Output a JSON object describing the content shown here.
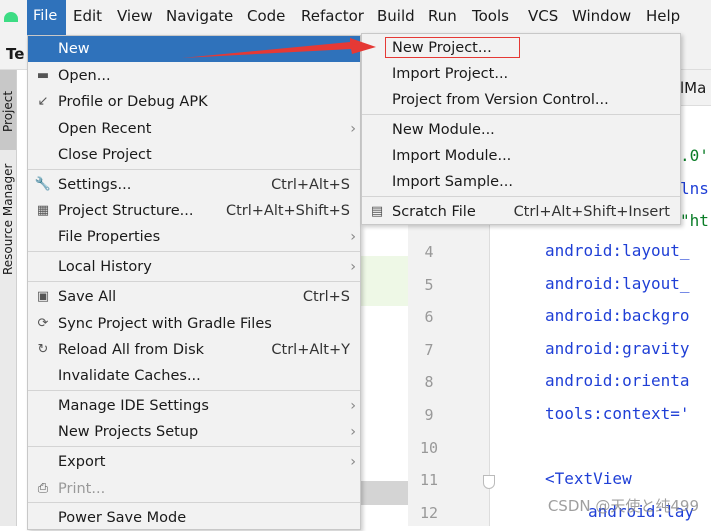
{
  "menubar": {
    "items": [
      "File",
      "Edit",
      "View",
      "Navigate",
      "Code",
      "Refactor",
      "Build",
      "Run",
      "Tools",
      "VCS",
      "Window",
      "Help"
    ]
  },
  "tabrow": {
    "project_tab": "Te",
    "editor_tab": "lMa"
  },
  "sidebar": {
    "project": "Project",
    "resource_manager": "Resource Manager"
  },
  "file_menu": {
    "items": [
      {
        "label": "New",
        "icon": "",
        "shortcut": "",
        "submenu": true
      },
      {
        "label": "Open...",
        "icon": "folder-icon",
        "shortcut": ""
      },
      {
        "label": "Profile or Debug APK",
        "icon": "profile-apk-icon",
        "shortcut": ""
      },
      {
        "label": "Open Recent",
        "icon": "",
        "shortcut": "",
        "submenu": true
      },
      {
        "label": "Close Project",
        "icon": "",
        "shortcut": ""
      },
      {
        "label": "Settings...",
        "icon": "wrench-icon",
        "shortcut": "Ctrl+Alt+S"
      },
      {
        "label": "Project Structure...",
        "icon": "project-structure-icon",
        "shortcut": "Ctrl+Alt+Shift+S"
      },
      {
        "label": "File Properties",
        "icon": "",
        "shortcut": "",
        "submenu": true
      },
      {
        "label": "Local History",
        "icon": "",
        "shortcut": "",
        "submenu": true
      },
      {
        "label": "Save All",
        "icon": "save-icon",
        "shortcut": "Ctrl+S"
      },
      {
        "label": "Sync Project with Gradle Files",
        "icon": "gradle-sync-icon",
        "shortcut": ""
      },
      {
        "label": "Reload All from Disk",
        "icon": "reload-icon",
        "shortcut": "Ctrl+Alt+Y"
      },
      {
        "label": "Invalidate Caches...",
        "icon": "",
        "shortcut": ""
      },
      {
        "label": "Manage IDE Settings",
        "icon": "",
        "shortcut": "",
        "submenu": true
      },
      {
        "label": "New Projects Setup",
        "icon": "",
        "shortcut": "",
        "submenu": true
      },
      {
        "label": "Export",
        "icon": "",
        "shortcut": "",
        "submenu": true
      },
      {
        "label": "Print...",
        "icon": "print-icon",
        "shortcut": "",
        "disabled": true
      },
      {
        "label": "Power Save Mode",
        "icon": "",
        "shortcut": ""
      }
    ]
  },
  "new_submenu": {
    "items": [
      {
        "label": "New Project...",
        "shortcut": ""
      },
      {
        "label": "Import Project...",
        "shortcut": ""
      },
      {
        "label": "Project from Version Control...",
        "shortcut": ""
      },
      {
        "label": "New Module...",
        "shortcut": ""
      },
      {
        "label": "Import Module...",
        "shortcut": ""
      },
      {
        "label": "Import Sample...",
        "shortcut": ""
      },
      {
        "label": "Scratch File",
        "shortcut": "Ctrl+Alt+Shift+Insert",
        "icon": "scratch-file-icon"
      }
    ]
  },
  "editor": {
    "partial": [
      ".0'",
      "lns",
      "\"ht"
    ],
    "lines": [
      {
        "n": "4",
        "text": "android:layout_"
      },
      {
        "n": "5",
        "text": "android:layout_"
      },
      {
        "n": "6",
        "text": "android:backgro"
      },
      {
        "n": "7",
        "text": "android:gravity"
      },
      {
        "n": "8",
        "text": "android:orienta"
      },
      {
        "n": "9",
        "text": "tools:context='"
      },
      {
        "n": "10",
        "text": ""
      },
      {
        "n": "11",
        "text": "<TextView"
      },
      {
        "n": "12",
        "text": "android:lay"
      }
    ]
  },
  "watermark": "CSDN @天使と纯499",
  "colors": {
    "selection": "#2f72bb",
    "annotation": "#e53935",
    "code": "#1f3fd6"
  }
}
